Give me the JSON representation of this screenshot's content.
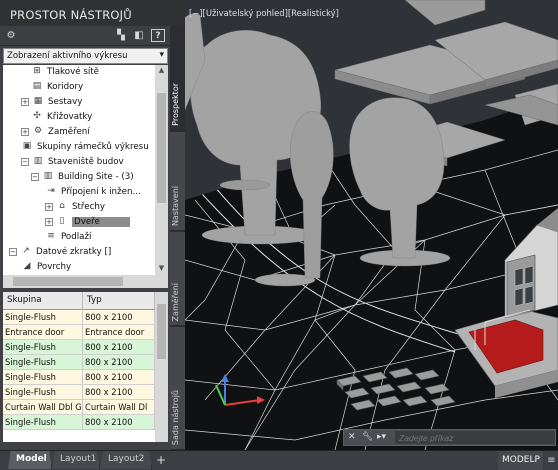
{
  "palette": {
    "title": "PROSTOR NÁSTROJŮ",
    "combo_value": "Zobrazení aktivního výkresu",
    "tree": [
      {
        "label": "Tlakové sítě",
        "toggle": "",
        "icon": "pressure-network-icon",
        "glyph": "⊞"
      },
      {
        "label": "Koridory",
        "toggle": "",
        "icon": "corridor-icon",
        "glyph": "▤"
      },
      {
        "label": "Sestavy",
        "toggle": "+",
        "icon": "assembly-icon",
        "glyph": "▦"
      },
      {
        "label": "Křižovatky",
        "toggle": "",
        "icon": "intersection-icon",
        "glyph": "✣"
      },
      {
        "label": "Zaměření",
        "toggle": "+",
        "icon": "survey-icon",
        "glyph": "⚙"
      },
      {
        "label": "Skupiny rámečků výkresu",
        "toggle": "",
        "icon": "viewframe-icon",
        "glyph": "▣"
      },
      {
        "label": "Staveniště budov",
        "toggle": "−",
        "icon": "building-site-icon",
        "glyph": "▥"
      },
      {
        "label": "Building Site - (3)",
        "toggle": "−",
        "icon": "building-site-item-icon",
        "glyph": "▥"
      },
      {
        "label": "Přípojení k inžen...",
        "toggle": "",
        "icon": "connection-icon",
        "glyph": "⇥"
      },
      {
        "label": "Střechy",
        "toggle": "●",
        "icon": "roof-icon",
        "glyph": "⌂"
      },
      {
        "label": "Dveře",
        "toggle": "●",
        "icon": "door-icon",
        "glyph": "▯"
      },
      {
        "label": "Podlaží",
        "toggle": "",
        "icon": "floor-icon",
        "glyph": "≡"
      },
      {
        "label": "Datové zkratky []",
        "toggle": "−",
        "icon": "data-shortcut-icon",
        "glyph": "↗"
      },
      {
        "label": "Povrchy",
        "toggle": "",
        "icon": "surface-icon",
        "glyph": "◢"
      }
    ],
    "selected_item": "Dveře",
    "grid": {
      "headers": [
        "Skupina",
        "Typ"
      ],
      "rows": [
        {
          "group": "Single-Flush",
          "type": "800 x 2100"
        },
        {
          "group": "Entrance door",
          "type": "Entrance door"
        },
        {
          "group": "Single-Flush",
          "type": "800 x 2100"
        },
        {
          "group": "Single-Flush",
          "type": "800 x 2100"
        },
        {
          "group": "Single-Flush",
          "type": "800 x 2100"
        },
        {
          "group": "Single-Flush",
          "type": "800 x 2100"
        },
        {
          "group": "Curtain Wall Dbl G",
          "type": "Curtain Wall Dl"
        },
        {
          "group": "Single-Flush",
          "type": "800 x 2100"
        }
      ],
      "row_colors": [
        "#fff8e0",
        "#fff8e0",
        "#d8f5d8",
        "#d8f5d8",
        "#fff8e0",
        "#fff8e0",
        "#fff8e0",
        "#d8f5d8"
      ]
    },
    "side_tabs": [
      "Prospektor",
      "Nastavení",
      "Zaměření",
      "Sada nástrojů"
    ],
    "active_tab": "Prospektor"
  },
  "viewport": {
    "label": "[−][Uživatelský pohled][Realistický]",
    "command_placeholder": "Zadejte příkaz",
    "colors": {
      "ground": "#0f1112",
      "grey_model": "#a7a7a7",
      "red_floor": "#b51b1b",
      "axis_x": "#e84040",
      "axis_y": "#4ad04a",
      "axis_z": "#4a7ee8"
    }
  },
  "bottom": {
    "tabs": [
      "Model",
      "Layout1",
      "Layout2"
    ],
    "active_tab": "Model",
    "plus": "+",
    "space": "MODELP"
  }
}
